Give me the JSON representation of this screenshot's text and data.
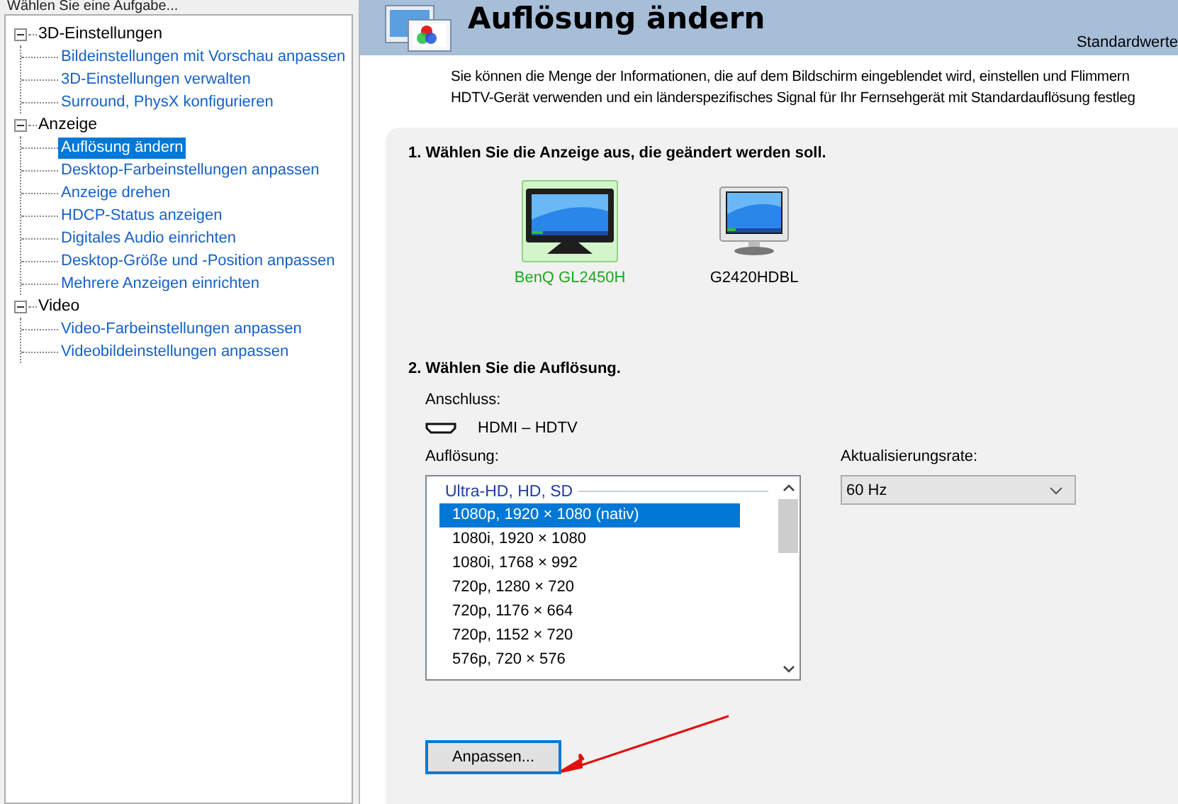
{
  "sidebar": {
    "title": "Wählen Sie eine Aufgabe...",
    "tree": [
      {
        "label": "3D-Einstellungen",
        "expanded": true,
        "children": [
          {
            "label": "Bildeinstellungen mit Vorschau anpassen",
            "selected": false
          },
          {
            "label": "3D-Einstellungen verwalten",
            "selected": false
          },
          {
            "label": "Surround, PhysX konfigurieren",
            "selected": false
          }
        ]
      },
      {
        "label": "Anzeige",
        "expanded": true,
        "children": [
          {
            "label": "Auflösung ändern",
            "selected": true
          },
          {
            "label": "Desktop-Farbeinstellungen anpassen",
            "selected": false
          },
          {
            "label": "Anzeige drehen",
            "selected": false
          },
          {
            "label": "HDCP-Status anzeigen",
            "selected": false
          },
          {
            "label": "Digitales Audio einrichten",
            "selected": false
          },
          {
            "label": "Desktop-Größe und -Position anpassen",
            "selected": false
          },
          {
            "label": "Mehrere Anzeigen einrichten",
            "selected": false
          }
        ]
      },
      {
        "label": "Video",
        "expanded": true,
        "children": [
          {
            "label": "Video-Farbeinstellungen anpassen",
            "selected": false
          },
          {
            "label": "Videobildeinstellungen anpassen",
            "selected": false
          }
        ]
      }
    ]
  },
  "page": {
    "title": "Auflösung ändern",
    "restore_link": "Standardwerte",
    "description": [
      "Sie können die Menge der Informationen, die auf dem Bildschirm eingeblendet wird, einstellen und Flimmern",
      "HDTV-Gerät verwenden und ein länderspezifisches Signal für Ihr Fernsehgerät mit Standardauflösung festleg"
    ]
  },
  "step1": {
    "heading": "1. Wählen Sie die Anzeige aus, die geändert werden soll.",
    "displays": [
      {
        "name": "BenQ GL2450H",
        "kind": "dark",
        "selected": true
      },
      {
        "name": "G2420HDBL",
        "kind": "light",
        "selected": false
      }
    ]
  },
  "step2": {
    "heading": "2. Wählen Sie die Auflösung.",
    "connector_label": "Anschluss:",
    "connector": "HDMI – HDTV",
    "resolution_label": "Auflösung:",
    "resolution_group": "Ultra-HD, HD, SD",
    "resolutions": [
      {
        "label": "1080p, 1920 × 1080 (nativ)",
        "selected": true
      },
      {
        "label": "1080i, 1920 × 1080",
        "selected": false
      },
      {
        "label": "1080i, 1768 × 992",
        "selected": false
      },
      {
        "label": "720p, 1280 × 720",
        "selected": false
      },
      {
        "label": "720p, 1176 × 664",
        "selected": false
      },
      {
        "label": "720p, 1152 × 720",
        "selected": false
      },
      {
        "label": "576p, 720 × 576",
        "selected": false
      }
    ],
    "refresh_label": "Aktualisierungsrate:",
    "refresh_value": "60 Hz",
    "customize_button": "Anpassen..."
  }
}
